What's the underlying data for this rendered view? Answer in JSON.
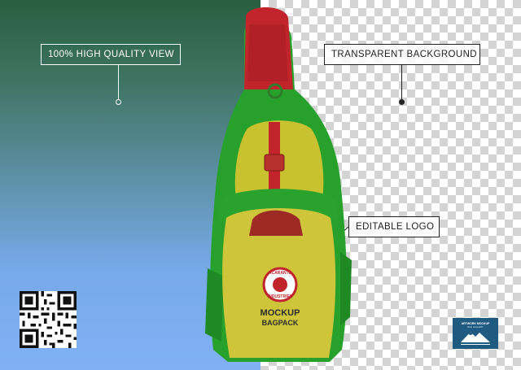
{
  "callouts": {
    "quality": "100% HIGH QUALITY VIEW",
    "transparent": "TRANSPARENT BACKGROUND",
    "logo": "EDITABLE LOGO"
  },
  "bag": {
    "logo_line1": "ACARANTE",
    "logo_line2": "INDUSTRIES",
    "mockup_text": "MOCKUP",
    "bagpack_text": "BAGPACK"
  },
  "badge": {
    "line1": "ARTWORK MOCKUP",
    "line2": "BAG GALLERY"
  },
  "colors": {
    "bag_green": "#28a12c",
    "bag_yellow": "#c8c130",
    "bag_red": "#c1252b",
    "left_bg_top": "#285f3f",
    "left_bg_bottom": "#80b1f6",
    "badge_bg": "#1f5a80"
  }
}
